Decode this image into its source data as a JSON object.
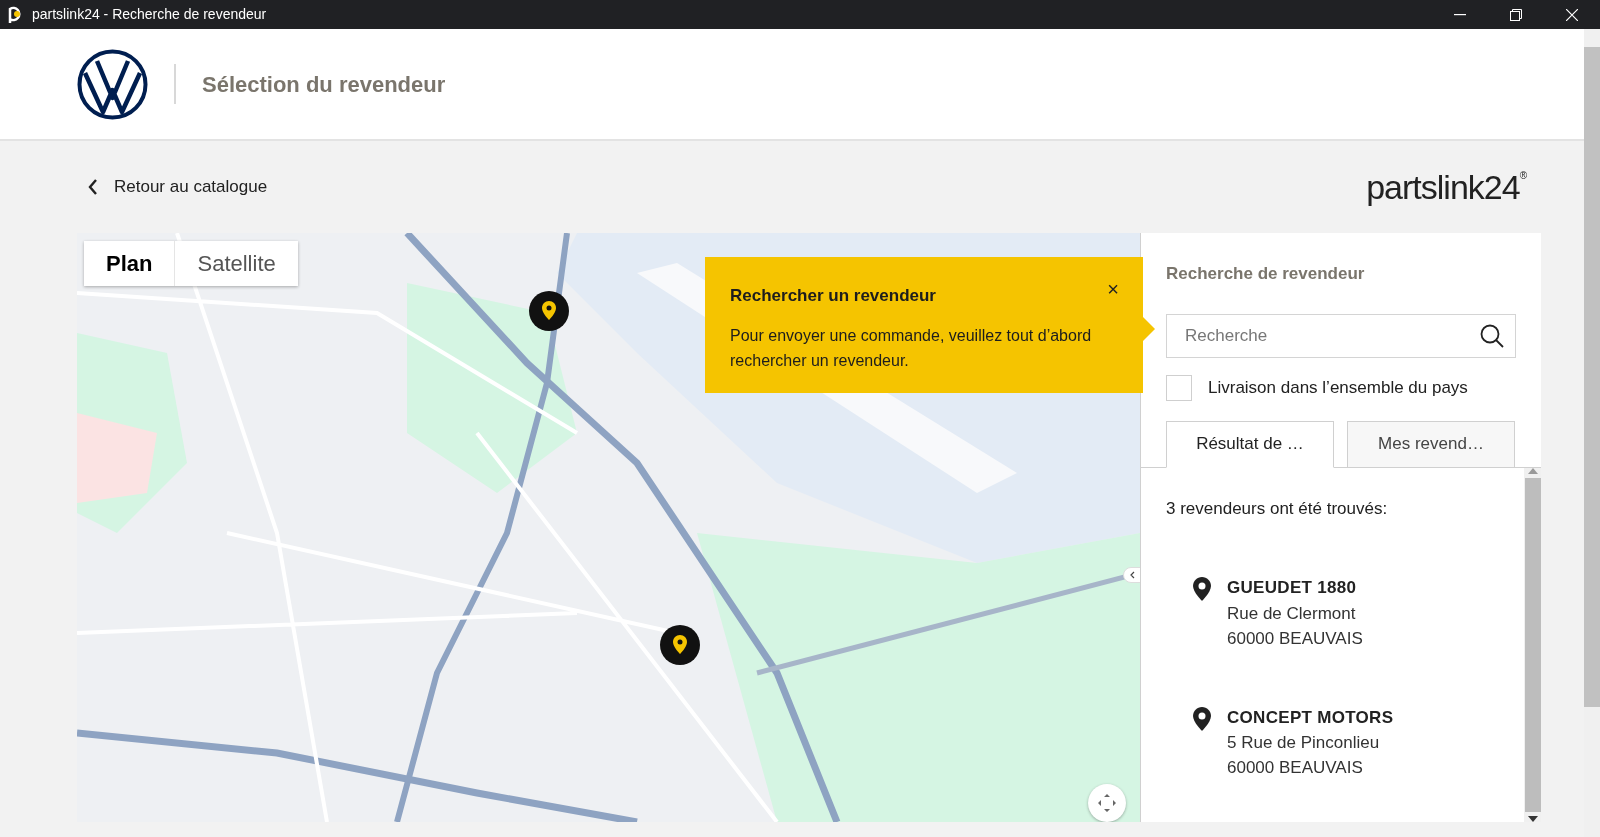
{
  "window": {
    "title": "partslink24 - Recherche de revendeur"
  },
  "header": {
    "title": "Sélection du revendeur"
  },
  "back_link": {
    "label": "Retour au catalogue"
  },
  "brand": {
    "name": "partslink24$^{®}$"
  },
  "map": {
    "view_tabs": [
      {
        "label": "Plan",
        "selected": true
      },
      {
        "label": "Satellite",
        "selected": false
      }
    ],
    "popup": {
      "title": "Rechercher un revendeur",
      "text": "Pour envoyer une commande, veuillez tout d’abord rechercher un revendeur.",
      "close": "×"
    }
  },
  "panel": {
    "title": "Recherche de revendeur",
    "search": {
      "placeholder": "Recherche"
    },
    "nationwide": {
      "label": "Livraison dans l’ensemble du pays",
      "checked": false
    },
    "tabs": [
      {
        "label": "Résultat de …",
        "selected": true
      },
      {
        "label": "Mes revend…",
        "selected": false
      }
    ],
    "result_count": "3 revendeurs ont été trouvés:",
    "dealers": [
      {
        "name": "GUEUDET 1880",
        "street": "Rue de Clermont",
        "city": "60000 BEAUVAIS"
      },
      {
        "name": "CONCEPT MOTORS",
        "street": "5 Rue de Pinconlieu",
        "city": "60000 BEAUVAIS"
      }
    ]
  }
}
